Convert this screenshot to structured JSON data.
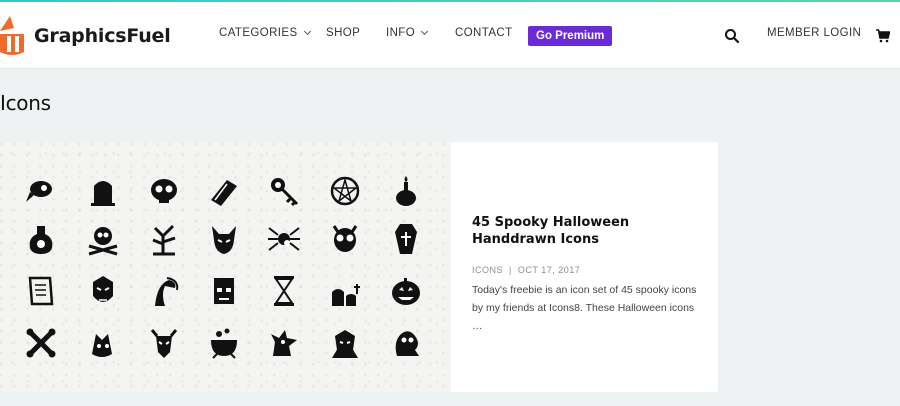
{
  "site": {
    "name": "GraphicsFuel"
  },
  "nav": {
    "items": [
      {
        "label": "CATEGORIES",
        "has_dropdown": true
      },
      {
        "label": "SHOP",
        "has_dropdown": false
      },
      {
        "label": "INFO",
        "has_dropdown": true
      },
      {
        "label": "CONTACT",
        "has_dropdown": false
      }
    ],
    "premium_label": "Go Premium",
    "member_login_label": "MEMBER LOGIN"
  },
  "page": {
    "title": "Icons"
  },
  "post": {
    "title": "45 Spooky Halloween Handdrawn Icons",
    "category": "ICONS",
    "separator": "|",
    "date": "OCT 17, 2017",
    "excerpt": "Today's freebie is an icon set of 45 spooky icons by my friends at Icons8. These Halloween icons …"
  },
  "thumbnail_icons": [
    "bird-skull-icon",
    "tombstone-icon",
    "skull-icon",
    "coffin-open-icon",
    "key-icon",
    "pentagram-icon",
    "candle-skull-icon",
    "potion-skull-icon",
    "skull-crossbones-icon",
    "dead-tree-icon",
    "devil-icon",
    "spider-icon",
    "skull-horns-icon",
    "coffin-icon",
    "scroll-icon",
    "dracula-icon",
    "grim-reaper-icon",
    "frankenstein-icon",
    "hourglass-icon",
    "graves-icon",
    "pumpkin-icon",
    "crossed-bones-icon",
    "werewolf-icon",
    "demon-icon",
    "cauldron-icon",
    "wolf-howl-icon",
    "vampire-icon",
    "ghost-icon"
  ],
  "colors": {
    "accent_premium": "#6a2bd6",
    "logo_orange": "#f06a2d",
    "page_bg": "#eef2f2"
  }
}
